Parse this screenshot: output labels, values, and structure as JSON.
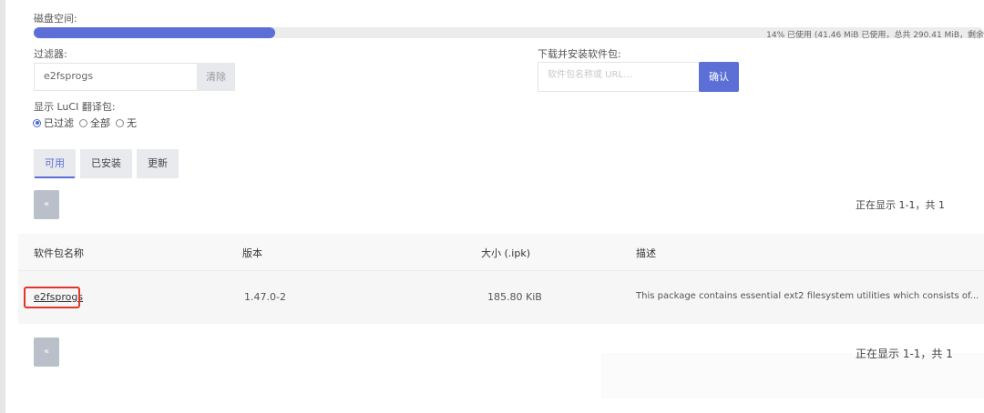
{
  "disk": {
    "label": "磁盘空间:",
    "usage_text": "14% 已使用 (41.46 MiB 已使用，总共 290.41 MiB，剩余",
    "percent": 14,
    "accent_color": "#5b6fd6"
  },
  "filter": {
    "label": "过滤器:",
    "value": "e2fsprogs",
    "clear_label": "清除"
  },
  "install": {
    "label": "下载并安装软件包:",
    "placeholder": "软件包名称或 URL…",
    "confirm_label": "确认"
  },
  "luci": {
    "label": "显示 LuCI 翻译包:",
    "options": [
      {
        "label": "已过滤",
        "checked": true
      },
      {
        "label": "全部",
        "checked": false
      },
      {
        "label": "无",
        "checked": false
      }
    ]
  },
  "tabs": [
    {
      "label": "可用",
      "active": true
    },
    {
      "label": "已安装",
      "active": false
    },
    {
      "label": "更新",
      "active": false
    }
  ],
  "pager": {
    "prev_label": "«",
    "status_text": "正在显示 1-1，共 1"
  },
  "table": {
    "headers": [
      "软件包名称",
      "版本",
      "大小 (.ipk)",
      "描述"
    ],
    "rows": [
      {
        "name": "e2fsprogs",
        "version": "1.47.0-2",
        "size": "185.80 KiB",
        "description": "This package contains essential ext2 filesystem utilities which consists of..."
      }
    ]
  }
}
